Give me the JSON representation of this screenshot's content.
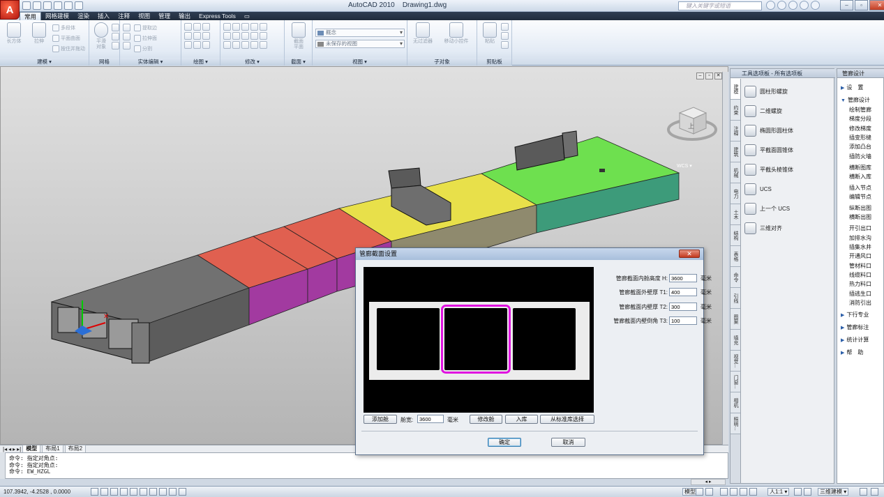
{
  "app": {
    "window_title": "AutoCAD 2010    Drawing1.dwg",
    "search_placeholder": "键入关键字或短语",
    "logo_letter": "A"
  },
  "tabs": [
    "常用",
    "网格建模",
    "渲染",
    "插入",
    "注释",
    "视图",
    "管理",
    "输出",
    "Express Tools"
  ],
  "ribbon": {
    "modeling": {
      "title": "建模 ▾",
      "box": "长方体",
      "extrude": "拉伸",
      "multibody": "多段体",
      "planar": "平面曲面",
      "presspull": "按住并拖动"
    },
    "mesh": {
      "title": "网格",
      "smooth": "平滑\n对象"
    },
    "solid_edit": {
      "title": "实体编辑 ▾",
      "extract": "提取边",
      "extrude_face": "拉伸面",
      "separate": "分割"
    },
    "draw": {
      "title": "绘图 ▾"
    },
    "modify": {
      "title": "修改 ▾"
    },
    "section": {
      "title": "截面 ▾",
      "plane": "截面\n平面"
    },
    "view": {
      "title": "视图 ▾",
      "visual_style": "概念",
      "saved_view": "未保存的视图"
    },
    "subobject": {
      "title": "子对象",
      "no_filter": "无过滤器",
      "move_gizmo": "移动小控件"
    },
    "clipboard": {
      "title": "剪贴板",
      "paste": "粘贴"
    }
  },
  "canvas": {
    "viewcube_top": "上",
    "wcs_label": "WCS ▾"
  },
  "layout_tabs": [
    "模型",
    "布局1",
    "布局2"
  ],
  "command_lines": [
    "命令: 指定对角点:",
    "命令: 指定对角点:",
    "命令: EW_HZGL"
  ],
  "status": {
    "coords": "107.3942, -4.2528 , 0.0000",
    "model": "模型",
    "scale": "人1:1 ▾",
    "workspace": "三维建模 ▾"
  },
  "palette": {
    "title": "工具选项板 - 所有选项板",
    "tabs": [
      "建模",
      "约束",
      "注释",
      "建筑",
      "机械",
      "电力",
      "土木",
      "结构",
      "表格",
      "命令",
      "引线",
      "图案",
      "填充",
      "视觉...",
      "门窗...",
      "相机",
      "照明..."
    ],
    "items": [
      "圆柱形螺旋",
      "二维螺旋",
      "椭圆形圆柱体",
      "平截面圆锥体",
      "平截头棱锥体",
      "UCS",
      "上一个 UCS",
      "三维对齐"
    ]
  },
  "pipe_panel": {
    "title": "管廊设计",
    "categories": [
      {
        "label": "设　置",
        "expanded": false
      },
      {
        "label": "管廊设计",
        "expanded": true,
        "subs": [
          "绘制管廊",
          "梯度分段",
          "修改梯度",
          "插变形缝",
          "添加凸台",
          "插防火墙",
          "横断图库",
          "横断入库",
          "插入节点",
          "编辑节点",
          "纵断出图",
          "横断出图",
          "开引出口",
          "加排水沟",
          "插集水井",
          "开通风口",
          "管材料口",
          "线缆料口",
          "热力料口",
          "插逃生口",
          "消防引出"
        ]
      },
      {
        "label": "下行专业",
        "expanded": false
      },
      {
        "label": "管廊标注",
        "expanded": false
      },
      {
        "label": "统计计算",
        "expanded": false
      },
      {
        "label": "帮　助",
        "expanded": false
      }
    ]
  },
  "dialog": {
    "title": "管廊截面设置",
    "close_label": "✕",
    "fields": [
      {
        "label": "管廊截面内舱高度 H:",
        "value": "3600",
        "unit": "毫米"
      },
      {
        "label": "管廊截面外壁厚 T1:",
        "value": "400",
        "unit": "毫米"
      },
      {
        "label": "管廊截面内壁厚 T2:",
        "value": "300",
        "unit": "毫米"
      },
      {
        "label": "管廊截面内壁倒角 T3:",
        "value": "100",
        "unit": "毫米"
      }
    ],
    "add_cabin": "添加舱",
    "cabin_width_label": "舱宽:",
    "cabin_width_value": "3600",
    "cabin_width_unit": "毫米",
    "modify_cabin": "修改舱",
    "store": "入库",
    "from_library": "从标准库选择",
    "ok": "确定",
    "cancel": "取消",
    "selected_cell": 2
  },
  "colors": {
    "gray_segment": "#717171",
    "red_segment": "#e06050",
    "magenta_side": "#a23aa0",
    "yellow_segment": "#e8e04a",
    "green_segment": "#6ee04f",
    "teal_side": "#3d9b7a",
    "highlight": "#e011e0"
  }
}
